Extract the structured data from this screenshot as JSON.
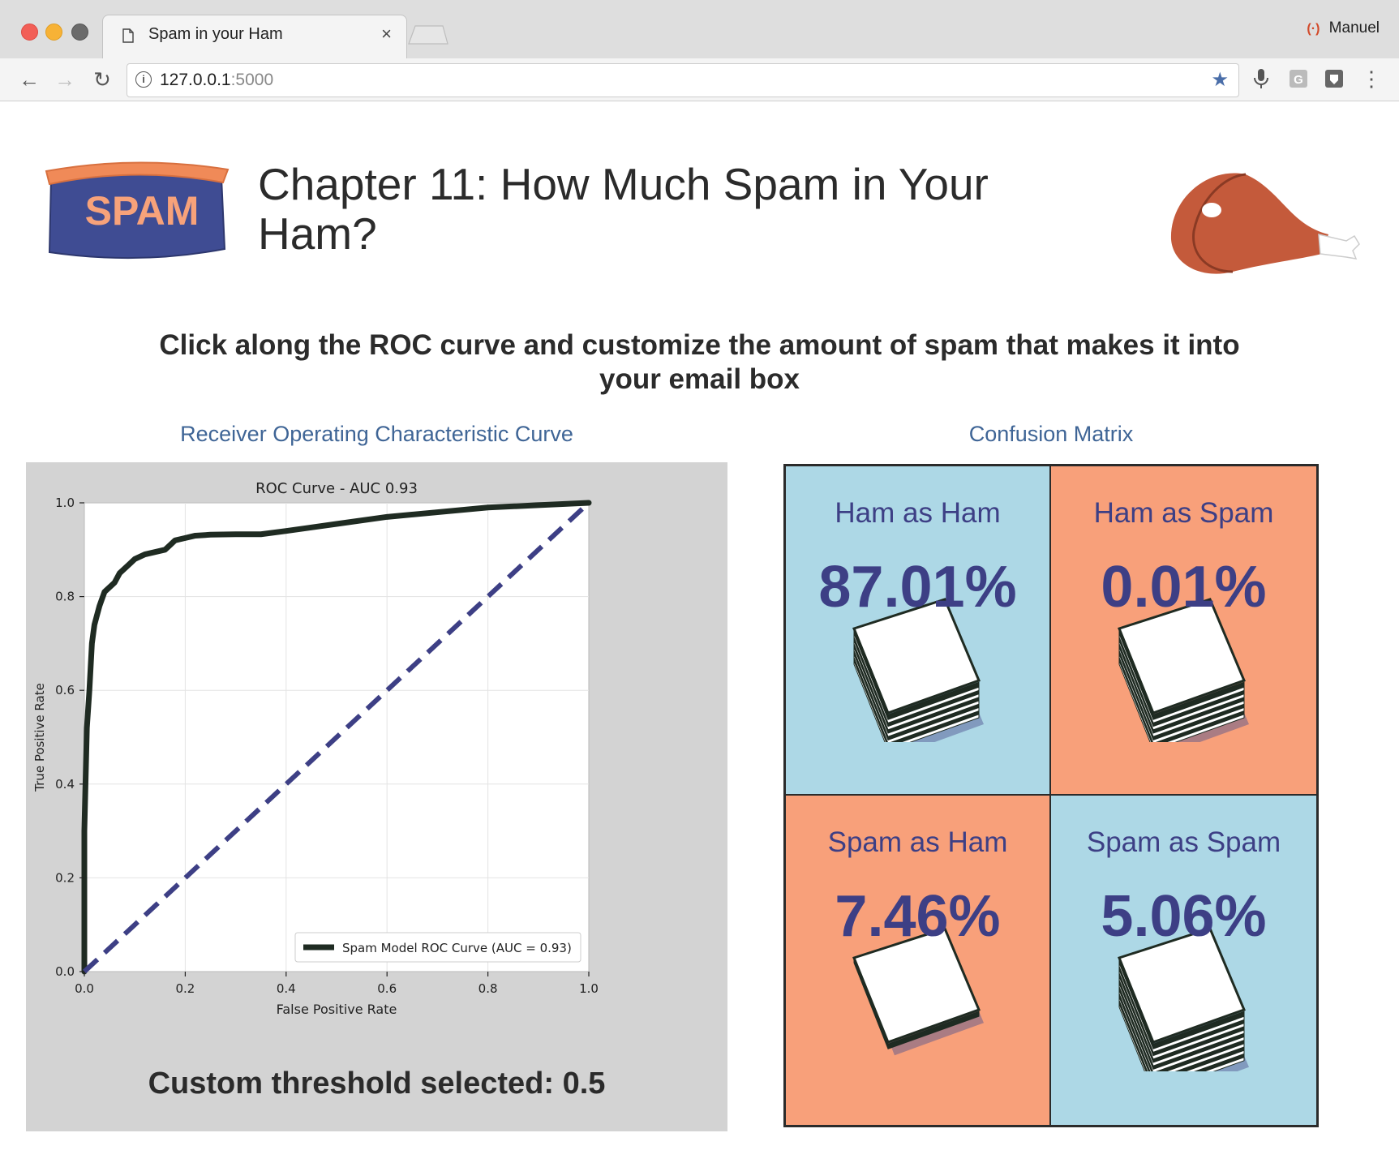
{
  "browser": {
    "tab_title": "Spam in your Ham",
    "tab_close": "×",
    "profile_name": "Manuel",
    "url_host": "127.0.0.1",
    "url_port": ":5000",
    "menu_glyph": "⋮",
    "star_glyph": "★",
    "back_glyph": "←",
    "forward_glyph": "→",
    "reload_glyph": "↻",
    "info_glyph": "i",
    "profile_glyph": "(·)"
  },
  "page": {
    "title": "Chapter 11: How Much Spam in Your Ham?",
    "logo_text": "SPAM",
    "instruction": "Click along the ROC curve and customize the amount of spam that makes it into your email box",
    "roc_heading": "Receiver Operating Characteristic Curve",
    "cm_heading": "Confusion Matrix",
    "threshold_text": "Custom threshold selected: 0.5",
    "colors": {
      "heading_blue": "#3f6596",
      "cell_blue": "#add8e6",
      "cell_orange": "#f8a07a",
      "matrix_text": "#3d3f85",
      "curve": "#1f2b22",
      "diagonal": "#3d3f85"
    }
  },
  "confusion_matrix": {
    "cells": [
      {
        "label": "Ham as Ham",
        "value": "87.01%",
        "color": "blue",
        "stack_level": 10
      },
      {
        "label": "Ham as Spam",
        "value": "0.01%",
        "color": "orange",
        "stack_level": 10
      },
      {
        "label": "Spam as Ham",
        "value": "7.46%",
        "color": "orange",
        "stack_level": 1
      },
      {
        "label": "Spam as Spam",
        "value": "5.06%",
        "color": "blue",
        "stack_level": 14
      }
    ]
  },
  "chart_data": {
    "type": "line",
    "title": "ROC Curve - AUC 0.93",
    "xlabel": "False Positive Rate",
    "ylabel": "True Positive Rate",
    "xlim": [
      0,
      1
    ],
    "ylim": [
      0,
      1
    ],
    "xticks": [
      "0.0",
      "0.2",
      "0.4",
      "0.6",
      "0.8",
      "1.0"
    ],
    "yticks": [
      "0.0",
      "0.2",
      "0.4",
      "0.6",
      "0.8",
      "1.0"
    ],
    "grid": true,
    "legend_position": "lower-right",
    "series": [
      {
        "name": "Spam Model ROC Curve (AUC = 0.93)",
        "style": "solid",
        "x": [
          0.0,
          0.0,
          0.005,
          0.01,
          0.015,
          0.02,
          0.025,
          0.03,
          0.04,
          0.05,
          0.06,
          0.07,
          0.08,
          0.09,
          0.1,
          0.12,
          0.14,
          0.16,
          0.17,
          0.18,
          0.2,
          0.22,
          0.25,
          0.3,
          0.35,
          0.4,
          0.5,
          0.6,
          0.7,
          0.8,
          0.9,
          1.0
        ],
        "y": [
          0.0,
          0.3,
          0.52,
          0.6,
          0.7,
          0.74,
          0.76,
          0.78,
          0.81,
          0.82,
          0.83,
          0.85,
          0.86,
          0.87,
          0.88,
          0.89,
          0.895,
          0.9,
          0.91,
          0.92,
          0.925,
          0.93,
          0.932,
          0.933,
          0.933,
          0.94,
          0.955,
          0.97,
          0.98,
          0.99,
          0.995,
          1.0
        ]
      },
      {
        "name": "",
        "style": "dashed",
        "x": [
          0.0,
          1.0
        ],
        "y": [
          0.0,
          1.0
        ]
      }
    ]
  }
}
